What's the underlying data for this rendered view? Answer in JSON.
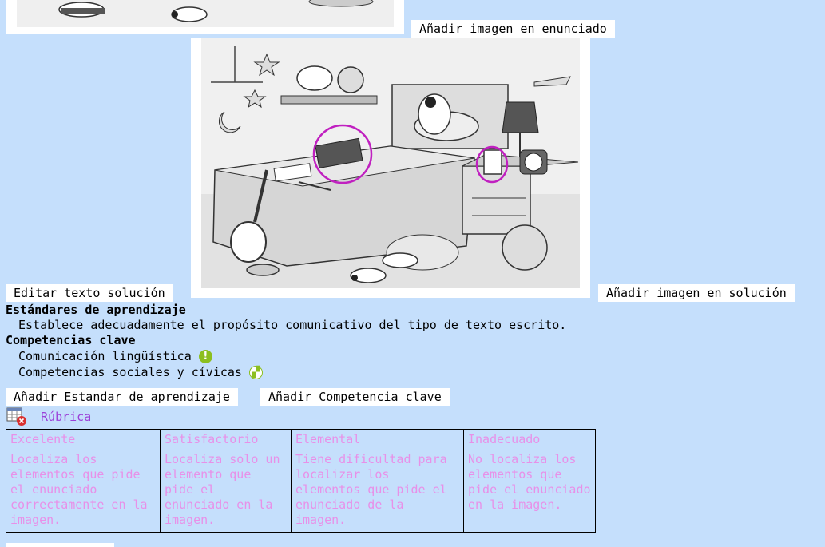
{
  "buttons": {
    "add_image_statement": "Añadir imagen en enunciado",
    "edit_solution_text": "Editar texto solución",
    "add_image_solution": "Añadir imagen en solución",
    "add_standard": "Añadir Estandar de aprendizaje",
    "add_competence": "Añadir Competencia clave"
  },
  "standards": {
    "heading": "Estándares de aprendizaje",
    "items": [
      "Establece adecuadamente el propósito comunicativo del tipo de texto escrito."
    ]
  },
  "competences": {
    "heading": "Competencias clave",
    "items": [
      {
        "label": "Comunicación lingüística",
        "icon": "exclamation-icon"
      },
      {
        "label": "Competencias sociales y cívicas",
        "icon": "ribbon-icon"
      }
    ]
  },
  "rubric": {
    "title": "Rúbrica",
    "icon": "rubric-delete-icon",
    "levels": [
      "Excelente",
      "Satisfactorio",
      "Elemental",
      "Inadecuado"
    ],
    "descriptors": [
      "Localiza los elementos que pide el enunciado correctamente en la imagen.",
      "Localiza solo un elemento que pide el enunciado en la imagen.",
      "Tiene dificultad para localizar los elementos que pide el enunciado de la imagen.",
      "No localiza los elementos que pide el enunciado en la imagen."
    ]
  },
  "colors": {
    "background": "#c5dffc",
    "rubric_text": "#e890e8",
    "rubric_link": "#9b40d8",
    "highlight_circle": "#c020c0"
  }
}
